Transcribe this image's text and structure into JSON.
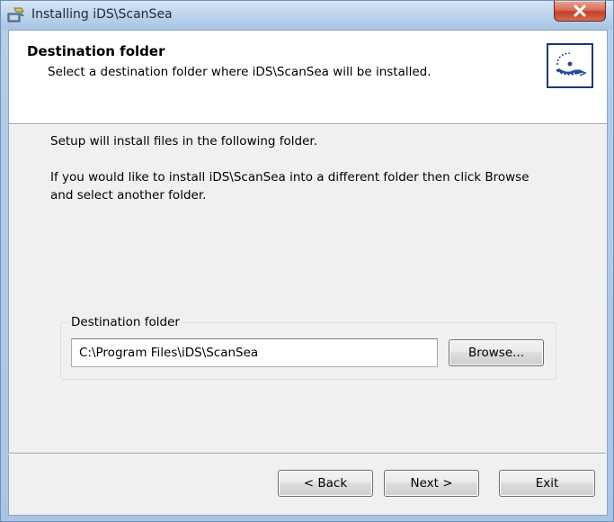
{
  "window": {
    "title": "Installing iDS\\ScanSea",
    "title_icon": "installer-icon",
    "close_icon": "close-icon"
  },
  "header": {
    "title": "Destination folder",
    "description": "Select a destination folder where iDS\\ScanSea will be installed.",
    "logo_icon": "scansea-logo-icon"
  },
  "body": {
    "line1": "Setup will install files in the following folder.",
    "line2": "If you would like to install iDS\\ScanSea into a different folder then click Browse and select another folder."
  },
  "destination": {
    "group_label": "Destination folder",
    "path_value": "C:\\Program Files\\iDS\\ScanSea",
    "browse_label": "Browse..."
  },
  "footer": {
    "back_label": "< Back",
    "next_label": "Next >",
    "exit_label": "Exit"
  },
  "colors": {
    "title_bar": "#b4cde8",
    "close_button": "#c1412b",
    "client_bg": "#f0f0f0",
    "header_bg": "#ffffff",
    "logo_border": "#163a7a"
  }
}
